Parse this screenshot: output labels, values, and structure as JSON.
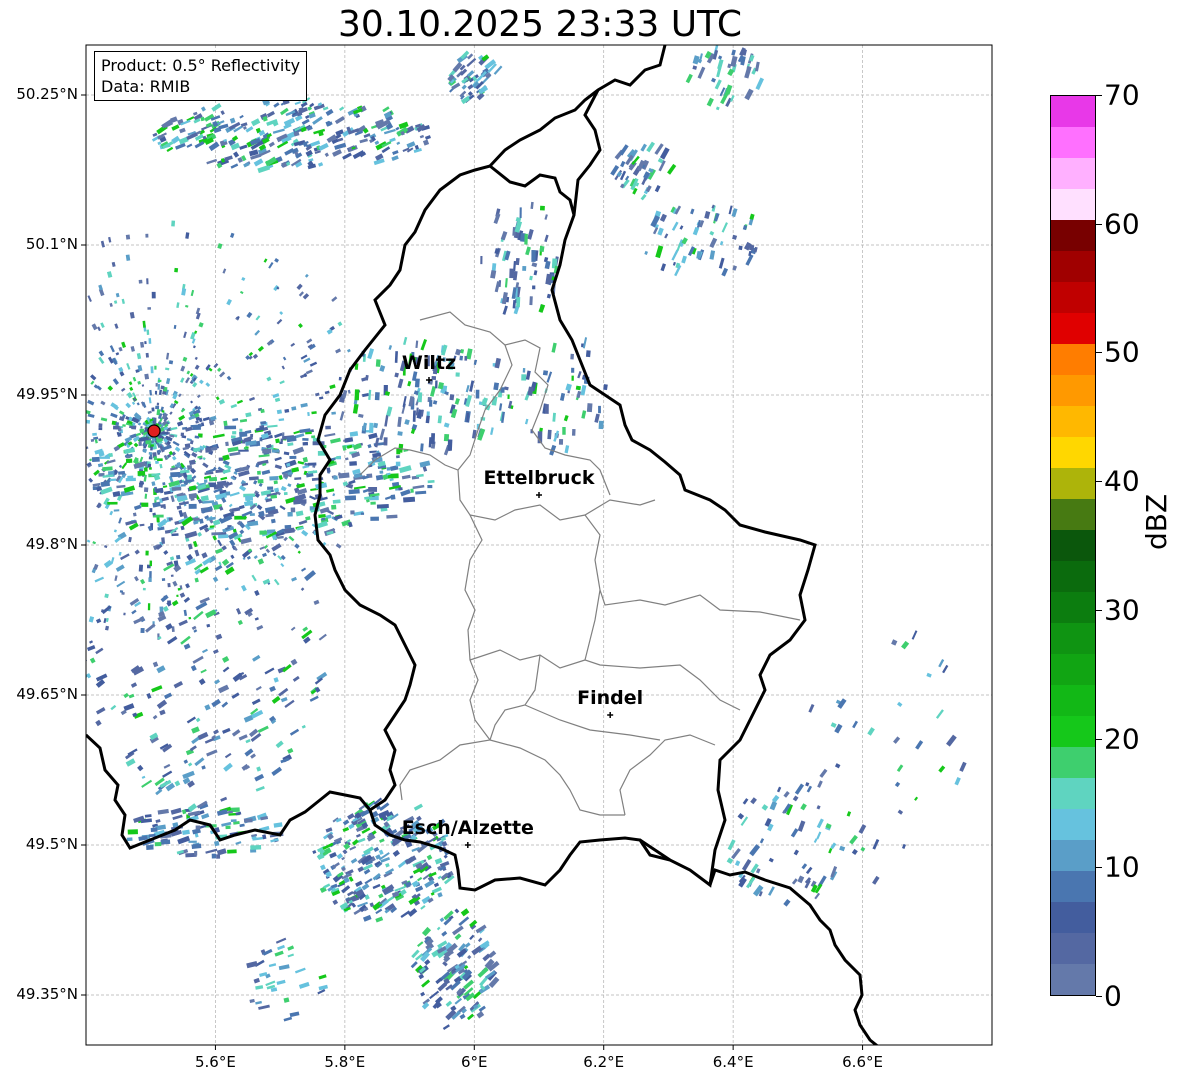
{
  "title": "30.10.2025 23:33 UTC",
  "info": {
    "product": "Product: 0.5° Reflectivity",
    "data": "Data: RMIB"
  },
  "map": {
    "lon_range": [
      5.4,
      6.8
    ],
    "lat_range": [
      49.3,
      50.3
    ],
    "lat_ticks": [
      "50.25°N",
      "50.1°N",
      "49.95°N",
      "49.8°N",
      "49.65°N",
      "49.5°N",
      "49.35°N"
    ],
    "lat_values": [
      50.25,
      50.1,
      49.95,
      49.8,
      49.65,
      49.5,
      49.35
    ],
    "lon_ticks": [
      "5.6°E",
      "5.8°E",
      "6°E",
      "6.2°E",
      "6.4°E",
      "6.6°E"
    ],
    "lon_values": [
      5.6,
      5.8,
      6.0,
      6.2,
      6.4,
      6.6
    ],
    "radar_site": "radar-site",
    "cities": [
      {
        "name": "Wiltz",
        "lon": 5.93,
        "lat": 49.965
      },
      {
        "name": "Ettelbruck",
        "lon": 6.1,
        "lat": 49.85
      },
      {
        "name": "Findel",
        "lon": 6.21,
        "lat": 49.63
      },
      {
        "name": "Esch/Alzette",
        "lon": 5.99,
        "lat": 49.5
      }
    ]
  },
  "colorbar": {
    "label": "dBZ",
    "min": 0,
    "max": 70,
    "ticks": [
      "0",
      "10",
      "20",
      "30",
      "40",
      "50",
      "60",
      "70"
    ],
    "colors": [
      "#6479aa",
      "#5468a2",
      "#435d9e",
      "#4a76b0",
      "#5a9ec8",
      "#66c2de",
      "#5fd4c0",
      "#3ecf6e",
      "#15c81a",
      "#12b816",
      "#11a513",
      "#0f9412",
      "#0c7d0f",
      "#0b6b0d",
      "#0b570c",
      "#477a12",
      "#adb40a",
      "#ffd700",
      "#ffb800",
      "#ff9900",
      "#ff7d00",
      "#e00000",
      "#c00000",
      "#a00000",
      "#780000",
      "#ffe0ff",
      "#ffb0ff",
      "#ff70ff",
      "#e838e8"
    ]
  }
}
